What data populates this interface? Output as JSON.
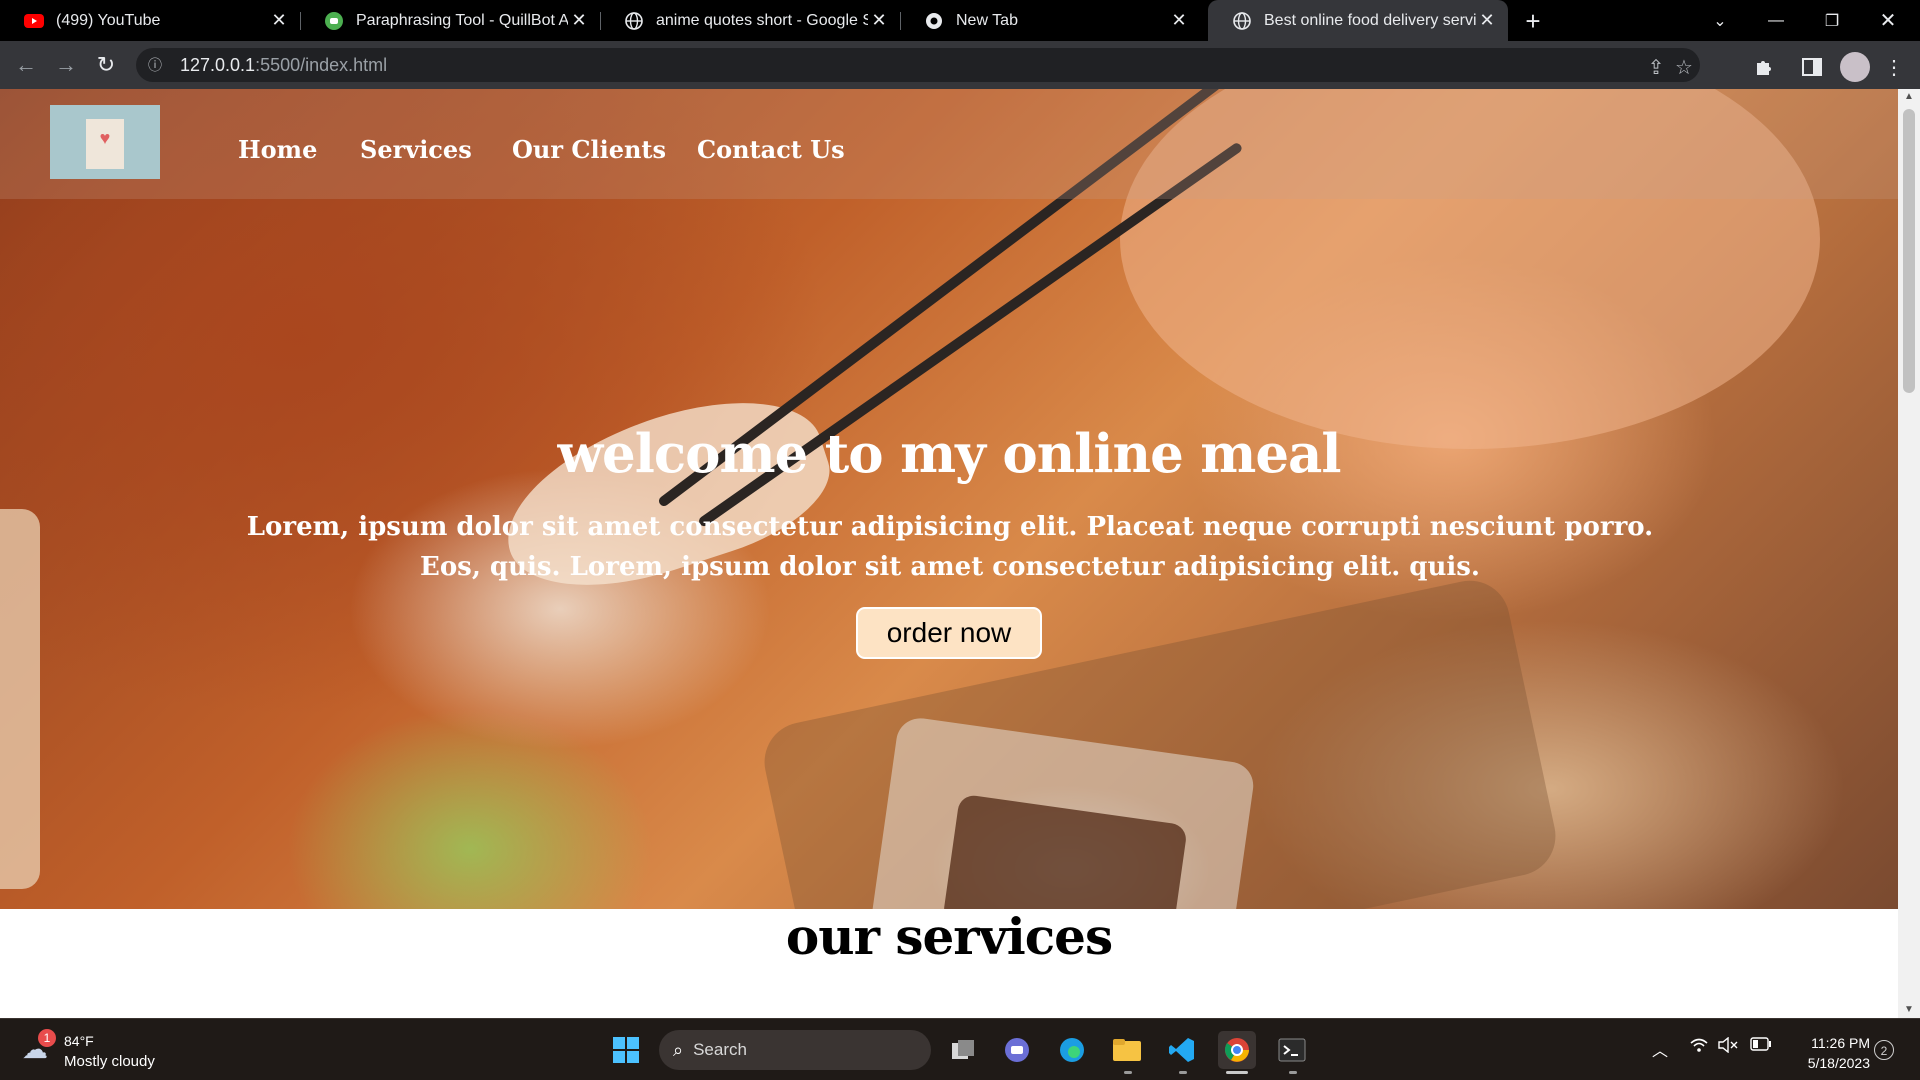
{
  "browser": {
    "tabs": [
      {
        "title": "(499) YouTube",
        "icon": "youtube-icon",
        "active": false
      },
      {
        "title": "Paraphrasing Tool - QuillBot AI",
        "icon": "quillbot-icon",
        "active": false
      },
      {
        "title": "anime quotes short - Google Sea",
        "icon": "globe-icon",
        "active": false
      },
      {
        "title": "New Tab",
        "icon": "chrome-icon",
        "active": false
      },
      {
        "title": "Best online food delivery services",
        "icon": "globe-icon",
        "active": true
      }
    ],
    "url_host": "127.0.0.1",
    "url_rest": ":5500/index.html"
  },
  "site": {
    "nav": [
      "Home",
      "Services",
      "Our Clients",
      "Contact Us"
    ],
    "hero_title": "welcome to my online meal",
    "hero_text": "Lorem, ipsum dolor sit amet consectetur adipisicing elit. Placeat neque corrupti nesciunt porro. Eos, quis. Lorem, ipsum dolor sit amet consectetur adipisicing elit. quis.",
    "order_button": "order now",
    "services_title": "our services"
  },
  "taskbar": {
    "weather_temp": "84°F",
    "weather_cond": "Mostly cloudy",
    "weather_badge": "1",
    "search_label": "Search",
    "time": "11:26 PM",
    "date": "5/18/2023",
    "notifications": "2"
  },
  "colors": {
    "tabstrip": "#000000",
    "toolbar": "#35363a",
    "order_button_bg": "#fde3c4",
    "taskbar": "#1f1a17"
  }
}
